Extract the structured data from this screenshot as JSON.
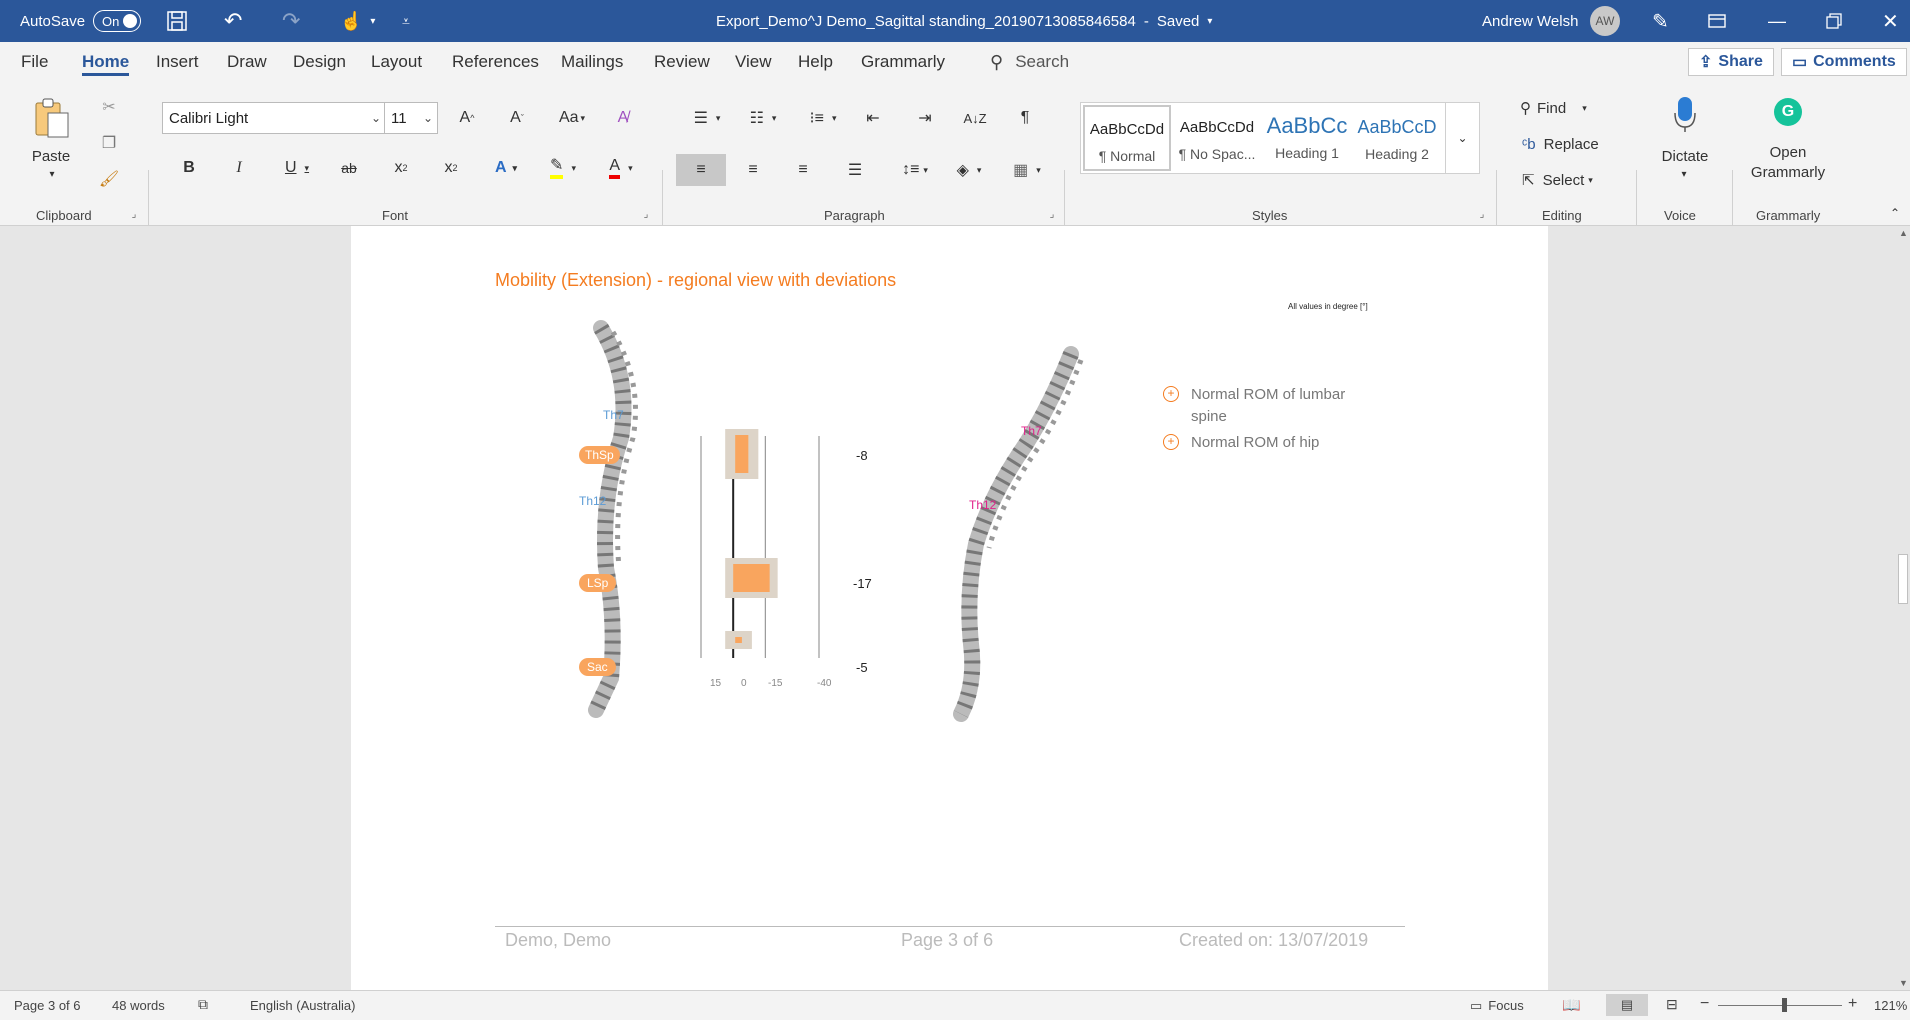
{
  "titlebar": {
    "autosave_label": "AutoSave",
    "autosave_state": "On",
    "document_title": "Export_Demo^J Demo_Sagittal standing_20190713085846584",
    "saved_status": "Saved",
    "user_name": "Andrew Welsh",
    "user_initials": "AW"
  },
  "menu": {
    "tabs": [
      "File",
      "Home",
      "Insert",
      "Draw",
      "Design",
      "Layout",
      "References",
      "Mailings",
      "Review",
      "View",
      "Help",
      "Grammarly"
    ],
    "active_tab": "Home",
    "search_placeholder": "Search",
    "share_label": "Share",
    "comments_label": "Comments"
  },
  "ribbon": {
    "clipboard": {
      "paste_label": "Paste",
      "group_label": "Clipboard"
    },
    "font": {
      "font_name": "Calibri Light",
      "font_size": "11",
      "group_label": "Font",
      "case_label": "Aa"
    },
    "paragraph": {
      "group_label": "Paragraph"
    },
    "styles": {
      "group_label": "Styles",
      "items": [
        {
          "preview": "AaBbCcDd",
          "name": "¶ Normal"
        },
        {
          "preview": "AaBbCcDd",
          "name": "¶ No Spac..."
        },
        {
          "preview": "AaBbCc",
          "name": "Heading 1"
        },
        {
          "preview": "AaBbCcD",
          "name": "Heading 2"
        }
      ]
    },
    "editing": {
      "find_label": "Find",
      "replace_label": "Replace",
      "select_label": "Select",
      "group_label": "Editing"
    },
    "voice": {
      "dictate_label": "Dictate",
      "group_label": "Voice"
    },
    "grammarly": {
      "open_label_1": "Open",
      "open_label_2": "Grammarly",
      "group_label": "Grammarly"
    }
  },
  "document": {
    "heading": "Mobility (Extension) - regional view with deviations",
    "units_note": "All values in degree [°]",
    "left_spine_labels": {
      "th7": "Th7",
      "thsp": "ThSp",
      "th12": "Th12",
      "lsp": "LSp",
      "sac": "Sac"
    },
    "right_spine_labels": {
      "th7": "Th7",
      "th12": "Th12"
    },
    "chart_values": [
      "-8",
      "-17",
      "-5"
    ],
    "axis_ticks": [
      "15",
      "0",
      "-15",
      "-40"
    ],
    "findings": [
      "Normal ROM of lumbar spine",
      "Normal ROM of hip"
    ],
    "footer": {
      "left": "Demo, Demo",
      "center": "Page 3 of 6",
      "right": "Created on: 13/07/2019"
    }
  },
  "chart_data": {
    "type": "bar",
    "categories": [
      "ThSp",
      "LSp",
      "Sac"
    ],
    "values": [
      -8,
      -17,
      -5
    ],
    "xticks": [
      15,
      0,
      -15,
      -40
    ],
    "xlim": [
      15,
      -40
    ]
  },
  "statusbar": {
    "page": "Page 3 of 6",
    "words": "48 words",
    "language": "English (Australia)",
    "focus_label": "Focus",
    "zoom": "121%"
  },
  "colors": {
    "word_blue": "#2b579a",
    "accent_orange": "#f47c20",
    "bar_orange": "#f9a55e",
    "label_blue": "#5b9bd5",
    "label_magenta": "#e0218a"
  }
}
